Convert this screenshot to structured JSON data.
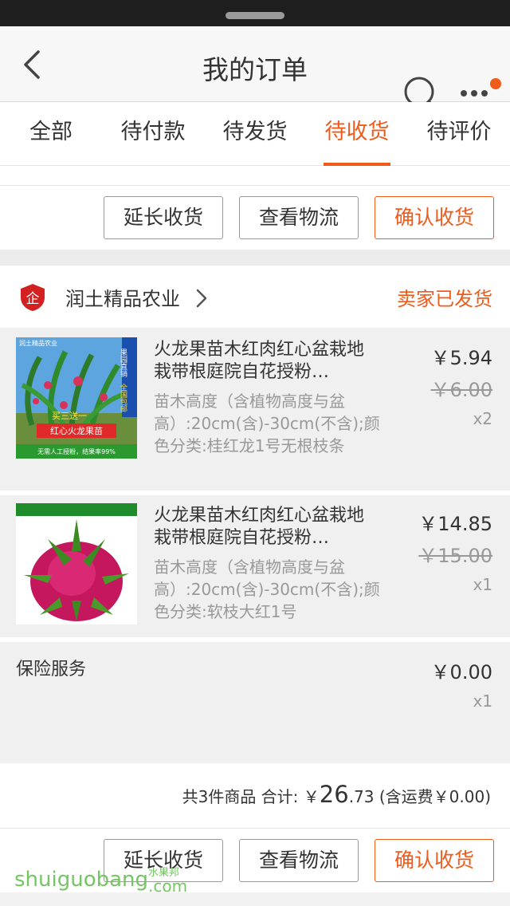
{
  "header": {
    "title": "我的订单"
  },
  "tabs": [
    {
      "label": "全部"
    },
    {
      "label": "待付款"
    },
    {
      "label": "待发货"
    },
    {
      "label": "待收货"
    },
    {
      "label": "待评价"
    }
  ],
  "active_tab": "待收货",
  "colors": {
    "accent": "#f05a1a",
    "badge_red": "#d32020"
  },
  "actions": {
    "extend": "延长收货",
    "logistics": "查看物流",
    "confirm": "确认收货"
  },
  "shop": {
    "badge_char": "企",
    "name": "润土精品农业",
    "status": "卖家已发货"
  },
  "items": [
    {
      "title": "火龙果苗木红肉红心盆栽地栽带根庭院自花授粉…",
      "sku": "苗木高度（含植物高度与盆高）:20cm(含)-30cm(不含);颜色分类:桂红龙1号无根枝条",
      "price": "￥5.94",
      "original_price": "￥6.00",
      "qty": "x2",
      "thumb_text": {
        "top_left": "润土精品农业",
        "side1": "果园直销",
        "side2": "全国包邮",
        "mid": "买三送一",
        "banner": "红心火龙果苗",
        "bottom": "无需人工授粉，结果率99%"
      }
    },
    {
      "title": "火龙果苗木红肉红心盆栽地栽带根庭院自花授粉…",
      "sku": "苗木高度（含植物高度与盆高）:20cm(含)-30cm(不含);颜色分类:软枝大红1号",
      "price": "￥14.85",
      "original_price": "￥15.00",
      "qty": "x1"
    }
  ],
  "insurance": {
    "label": "保险服务",
    "price": "￥0.00",
    "qty": "x1"
  },
  "summary": {
    "prefix": "共3件商品 合计: ￥",
    "amount_int": "26",
    "amount_dec": ".73",
    "suffix": " (含运费￥0.00)"
  },
  "watermark": {
    "main": "shuiguobang",
    "sub": "水果邦",
    "domain": ".com"
  }
}
